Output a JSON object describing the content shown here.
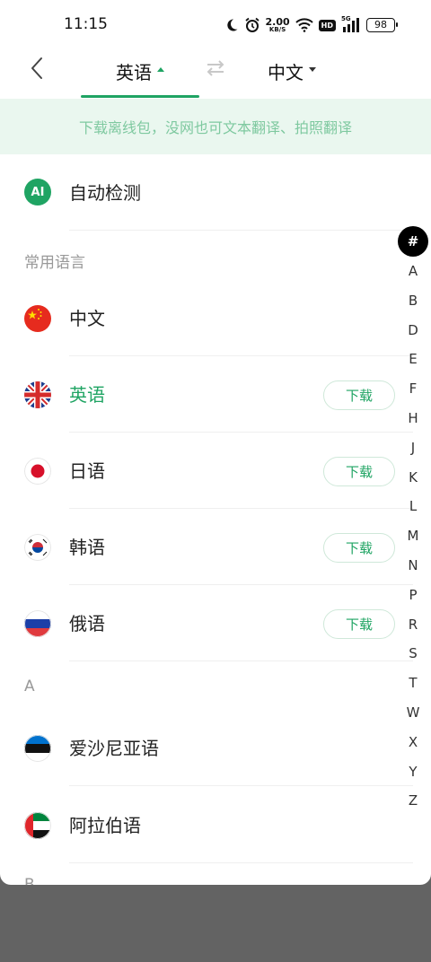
{
  "status_bar": {
    "time": "11:15",
    "net_speed_value": "2.00",
    "net_speed_unit": "KB/S",
    "hd_label": "HD",
    "signal_label": "5G",
    "battery": "98"
  },
  "header": {
    "source_language": "英语",
    "target_language": "中文"
  },
  "banner": {
    "text": "下载离线包，没网也可文本翻译、拍照翻译"
  },
  "auto_detect": {
    "badge": "AI",
    "label": "自动检测"
  },
  "sections": {
    "common": "常用语言",
    "a": "A",
    "b": "B"
  },
  "common_languages": [
    {
      "name": "中文",
      "download": ""
    },
    {
      "name": "英语",
      "download": "下载"
    },
    {
      "name": "日语",
      "download": "下载"
    },
    {
      "name": "韩语",
      "download": "下载"
    },
    {
      "name": "俄语",
      "download": "下载"
    }
  ],
  "a_languages": [
    {
      "name": "爱沙尼亚语"
    },
    {
      "name": "阿拉伯语"
    }
  ],
  "index": [
    "#",
    "A",
    "B",
    "D",
    "E",
    "F",
    "H",
    "J",
    "K",
    "L",
    "M",
    "N",
    "P",
    "R",
    "S",
    "T",
    "W",
    "X",
    "Y",
    "Z"
  ],
  "colors": {
    "accent": "#1fa463",
    "banner_bg": "#eaf7ef",
    "banner_text": "#7fc9a0",
    "scrim": "#636363"
  }
}
